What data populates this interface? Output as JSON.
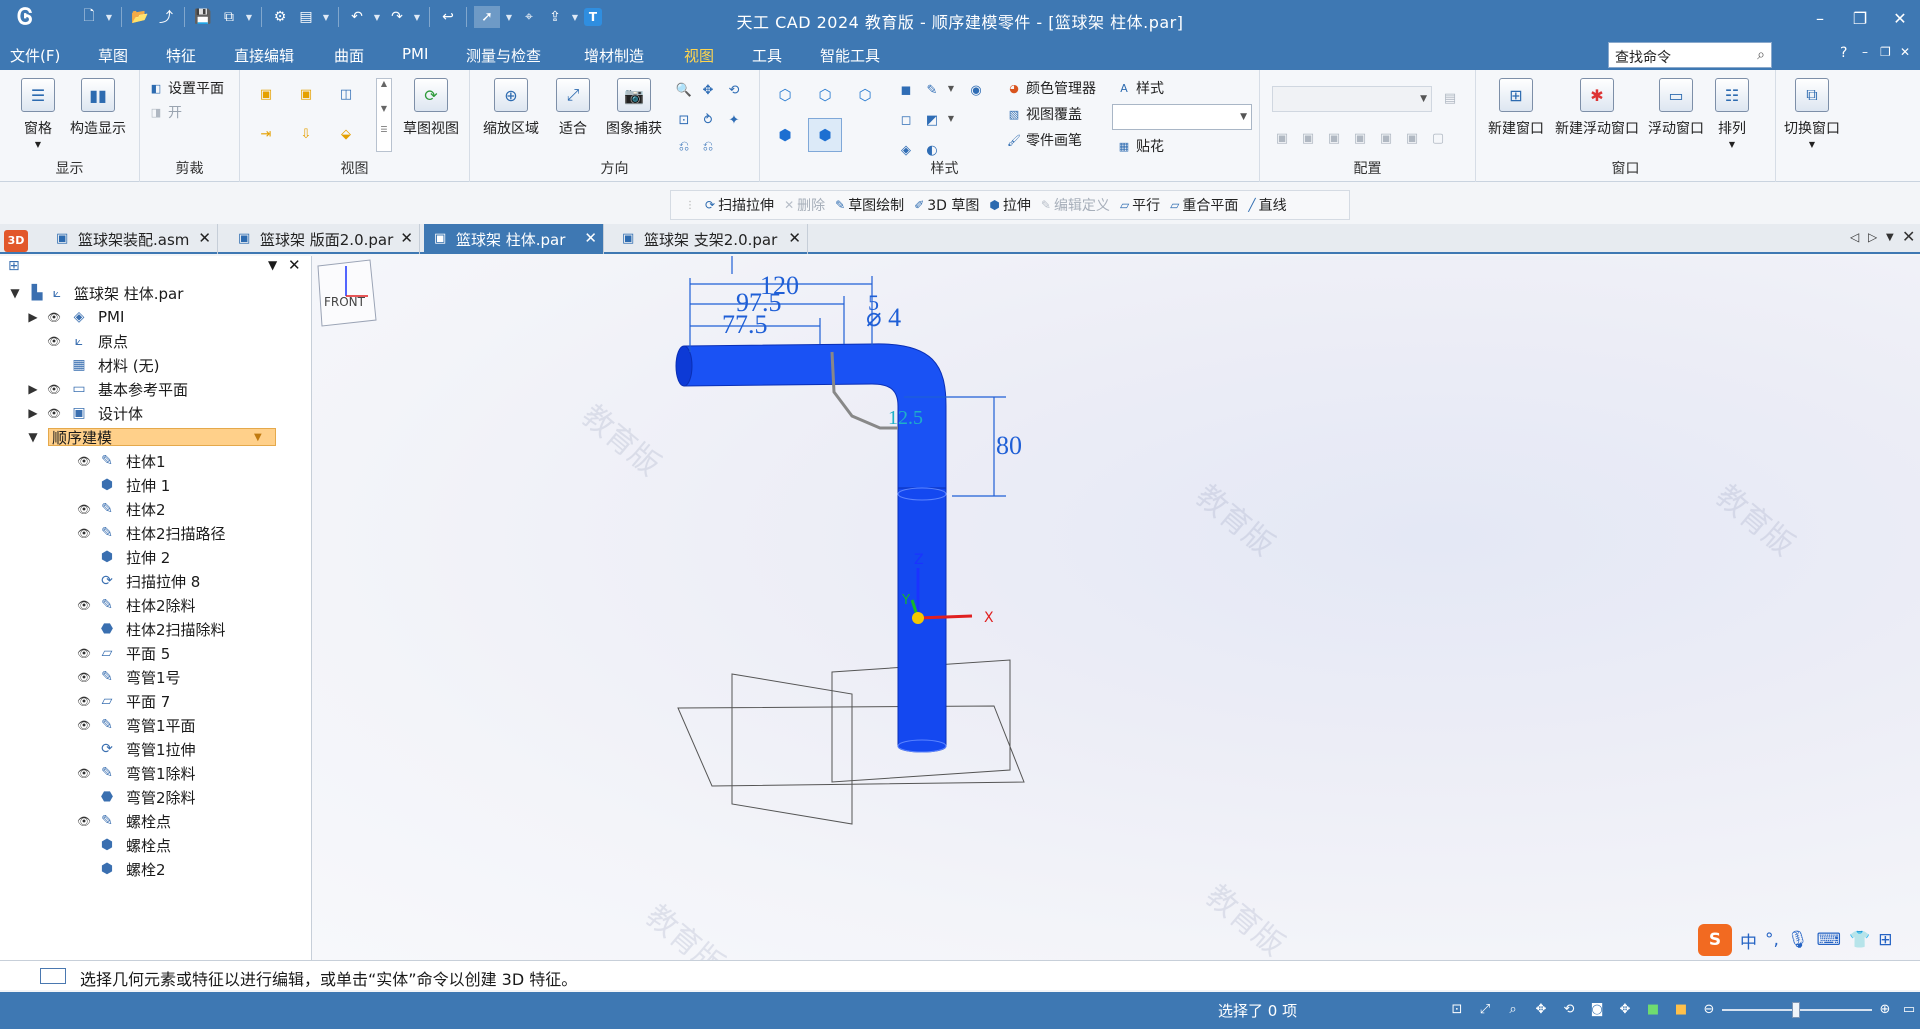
{
  "titlebar": {
    "title": "天工 CAD 2024 教育版 - 顺序建模零件 - [篮球架 柱体.par]",
    "minimize": "–",
    "restore": "❐",
    "close": "✕"
  },
  "menu": {
    "items": [
      "文件(F)",
      "草图",
      "特征",
      "直接编辑",
      "曲面",
      "PMI",
      "测量与检查",
      "增材制造",
      "视图",
      "工具",
      "智能工具"
    ],
    "active": "视图",
    "search_placeholder": "查找命令",
    "help": "?",
    "sub_min": "–",
    "sub_restore": "❐",
    "sub_close": "✕"
  },
  "ribbon": {
    "display": {
      "label": "显示",
      "pane": "窗格",
      "construct_display": "构造显示"
    },
    "clip": {
      "label": "剪裁",
      "set_plane": "设置平面",
      "on": "开"
    },
    "view": {
      "label": "视图",
      "sketch_view": "草图视图"
    },
    "orient": {
      "label": "方向",
      "zoom_area": "缩放区域",
      "fit": "适合",
      "image_capture": "图象捕获"
    },
    "style": {
      "label": "样式",
      "color_manager": "颜色管理器",
      "view_overlay": "视图覆盖",
      "part_painter": "零件画笔",
      "style": "样式",
      "decal": "贴花"
    },
    "config": {
      "label": "配置"
    },
    "window": {
      "label": "窗口",
      "new_window": "新建窗口",
      "new_float": "新建浮动窗口",
      "float": "浮动窗口",
      "arrange": "排列",
      "switch": "切换窗口"
    }
  },
  "cmdbar": {
    "items": [
      {
        "label": "扫描拉伸",
        "icon": "sweep-icon",
        "enabled": true
      },
      {
        "label": "删除",
        "icon": "delete-icon",
        "enabled": false
      },
      {
        "label": "草图绘制",
        "icon": "sketch-icon",
        "enabled": true
      },
      {
        "label": "3D 草图",
        "icon": "sketch3d-icon",
        "enabled": true
      },
      {
        "label": "拉伸",
        "icon": "extrude-icon",
        "enabled": true
      },
      {
        "label": "编辑定义",
        "icon": "edit-definition-icon",
        "enabled": false
      },
      {
        "label": "平行",
        "icon": "parallel-icon",
        "enabled": true
      },
      {
        "label": "重合平面",
        "icon": "coincident-plane-icon",
        "enabled": true
      },
      {
        "label": "直线",
        "icon": "line-icon",
        "enabled": true
      }
    ]
  },
  "tabs": {
    "app_badge": "3D",
    "items": [
      {
        "label": "篮球架装配.asm",
        "active": false
      },
      {
        "label": "篮球架 版面2.0.par",
        "active": false
      },
      {
        "label": "篮球架 柱体.par",
        "active": true
      },
      {
        "label": "篮球架 支架2.0.par",
        "active": false
      }
    ]
  },
  "tree": {
    "root": "篮球架 柱体.par",
    "items": [
      {
        "label": "PMI",
        "level": 1,
        "expander": "▶",
        "eye": true,
        "icon": "pmi-icon"
      },
      {
        "label": "原点",
        "level": 1,
        "expander": "",
        "eye": true,
        "icon": "origin-icon"
      },
      {
        "label": "材料 (无)",
        "level": 1,
        "expander": "",
        "eye": false,
        "icon": "material-icon"
      },
      {
        "label": "基本参考平面",
        "level": 1,
        "expander": "▶",
        "eye": true,
        "icon": "ref-plane-icon"
      },
      {
        "label": "设计体",
        "level": 1,
        "expander": "▶",
        "eye": true,
        "icon": "design-body-icon"
      },
      {
        "label": "顺序建模",
        "level": 1,
        "expander": "▼",
        "eye": false,
        "icon": "",
        "selected": true
      },
      {
        "label": "柱体1",
        "level": 2,
        "eye": true,
        "icon": "sketch-icon"
      },
      {
        "label": "拉伸 1",
        "level": 2,
        "eye": false,
        "icon": "extrude-icon"
      },
      {
        "label": "柱体2",
        "level": 2,
        "eye": true,
        "icon": "sketch-icon"
      },
      {
        "label": "柱体2扫描路径",
        "level": 2,
        "eye": true,
        "icon": "sketch-icon"
      },
      {
        "label": "拉伸 2",
        "level": 2,
        "eye": false,
        "icon": "extrude-icon"
      },
      {
        "label": "扫描拉伸 8",
        "level": 2,
        "eye": false,
        "icon": "sweep-icon"
      },
      {
        "label": "柱体2除料",
        "level": 2,
        "eye": true,
        "icon": "sketch-icon"
      },
      {
        "label": "柱体2扫描除料",
        "level": 2,
        "eye": false,
        "icon": "cut-icon"
      },
      {
        "label": "平面 5",
        "level": 2,
        "eye": true,
        "icon": "plane-icon"
      },
      {
        "label": "弯管1号",
        "level": 2,
        "eye": true,
        "icon": "sketch-icon"
      },
      {
        "label": "平面 7",
        "level": 2,
        "eye": true,
        "icon": "plane-icon"
      },
      {
        "label": "弯管1平面",
        "level": 2,
        "eye": true,
        "icon": "sketch-icon"
      },
      {
        "label": "弯管1拉伸",
        "level": 2,
        "eye": false,
        "icon": "sweep-icon"
      },
      {
        "label": "弯管1除料",
        "level": 2,
        "eye": true,
        "icon": "sketch-icon"
      },
      {
        "label": "弯管2除料",
        "level": 2,
        "eye": false,
        "icon": "cut-icon"
      },
      {
        "label": "螺栓点",
        "level": 2,
        "eye": true,
        "icon": "sketch-icon"
      },
      {
        "label": "螺栓点",
        "level": 2,
        "eye": false,
        "icon": "extrude-icon"
      },
      {
        "label": "螺栓2",
        "level": 2,
        "eye": false,
        "icon": "extrude-icon"
      }
    ]
  },
  "viewport": {
    "dims": {
      "d120": "120",
      "d97": "97.5",
      "d77": "77.5",
      "diam": "⌀ 4",
      "d80": "80",
      "d125": "12.5",
      "five": "5"
    },
    "watermark": "教育版",
    "axis_x": "X",
    "axis_y": "Y",
    "axis_z": "Z",
    "view_cube_label": "FRONT",
    "part_color": "#1448f0"
  },
  "prompt": {
    "text": "选择几何元素或特征以进行编辑，或单击“实体”命令以创建 3D 特征。"
  },
  "status": {
    "selected": "选择了 0 项"
  },
  "ime": {
    "logo": "S",
    "mode": "中"
  }
}
